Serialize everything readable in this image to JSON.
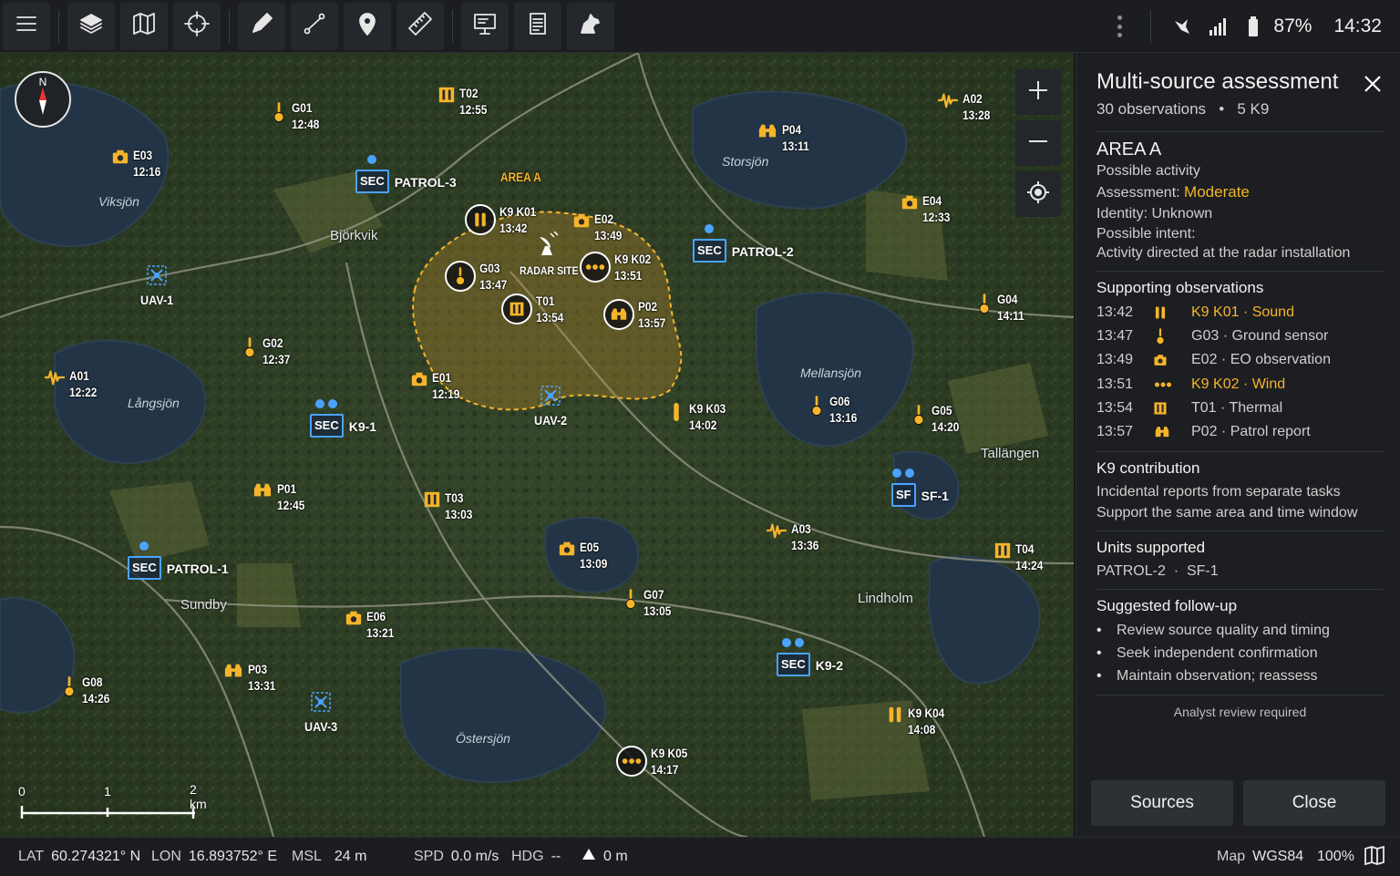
{
  "toolbar": {
    "buttons": [
      "menu-icon",
      "layers-icon",
      "map-icon",
      "crosshair-icon",
      "pencil-icon",
      "route-icon",
      "pin-icon",
      "ruler-icon",
      "presentation-icon",
      "report-icon",
      "dog-icon"
    ]
  },
  "status": {
    "battery": "87%",
    "time": "14:32"
  },
  "map": {
    "lakes": [
      "Viksjön",
      "Storsjön",
      "Långsjön",
      "Mellansjön",
      "Östersjön"
    ],
    "places": [
      "Björkvik",
      "Tallängen",
      "Sundby",
      "Lindholm"
    ],
    "compass": "N",
    "area": {
      "name": "AREA A",
      "radar": "RADAR SITE"
    },
    "scale": [
      "0",
      "1",
      "2 km"
    ],
    "markers": [
      {
        "id": "G01",
        "time": "12:48",
        "kind": "ground"
      },
      {
        "id": "T02",
        "time": "12:55",
        "kind": "thermal"
      },
      {
        "id": "E03",
        "time": "12:16",
        "kind": "eo"
      },
      {
        "id": "K9 K01",
        "time": "13:42",
        "kind": "sound"
      },
      {
        "id": "E02",
        "time": "13:49",
        "kind": "eo"
      },
      {
        "id": "K9 K02",
        "time": "13:51",
        "kind": "wind"
      },
      {
        "id": "G03",
        "time": "13:47",
        "kind": "ground"
      },
      {
        "id": "T01",
        "time": "13:54",
        "kind": "thermal"
      },
      {
        "id": "P02",
        "time": "13:57",
        "kind": "patrol"
      },
      {
        "id": "P04",
        "time": "13:11",
        "kind": "patrol"
      },
      {
        "id": "A02",
        "time": "13:28",
        "kind": "acoustic"
      },
      {
        "id": "E04",
        "time": "12:33",
        "kind": "eo"
      },
      {
        "id": "G04",
        "time": "14:11",
        "kind": "ground"
      },
      {
        "id": "G02",
        "time": "12:37",
        "kind": "ground"
      },
      {
        "id": "A01",
        "time": "12:22",
        "kind": "acoustic"
      },
      {
        "id": "E01",
        "time": "12:19",
        "kind": "eo"
      },
      {
        "id": "K9 K03",
        "time": "14:02",
        "kind": "k9single"
      },
      {
        "id": "G06",
        "time": "13:16",
        "kind": "ground"
      },
      {
        "id": "G05",
        "time": "14:20",
        "kind": "ground"
      },
      {
        "id": "P01",
        "time": "12:45",
        "kind": "patrol"
      },
      {
        "id": "T03",
        "time": "13:03",
        "kind": "thermal"
      },
      {
        "id": "E05",
        "time": "13:09",
        "kind": "eo"
      },
      {
        "id": "A03",
        "time": "13:36",
        "kind": "acoustic"
      },
      {
        "id": "T04",
        "time": "14:24",
        "kind": "thermal"
      },
      {
        "id": "G07",
        "time": "13:05",
        "kind": "ground"
      },
      {
        "id": "E06",
        "time": "13:21",
        "kind": "eo"
      },
      {
        "id": "P03",
        "time": "13:31",
        "kind": "patrol"
      },
      {
        "id": "G08",
        "time": "14:26",
        "kind": "ground"
      },
      {
        "id": "K9 K04",
        "time": "14:08",
        "kind": "sound"
      },
      {
        "id": "K9 K05",
        "time": "14:17",
        "kind": "wind"
      }
    ],
    "units": [
      {
        "box": "SEC",
        "name": "PATROL-3"
      },
      {
        "box": "SEC",
        "name": "PATROL-2"
      },
      {
        "box": "SEC",
        "name": "K9-1"
      },
      {
        "box": "SF",
        "name": "SF-1"
      },
      {
        "box": "SEC",
        "name": "PATROL-1"
      },
      {
        "box": "SEC",
        "name": "K9-2"
      }
    ],
    "uavs": [
      "UAV-1",
      "UAV-2",
      "UAV-3"
    ]
  },
  "panel": {
    "title": "Multi-source assessment",
    "subtitle_obs": "30 observations",
    "subtitle_dot": "•",
    "subtitle_k9": "5 K9",
    "area": {
      "name": "AREA A",
      "activity": "Possible activity",
      "assessment_label": "Assessment:",
      "assessment_value": "Moderate",
      "identity": "Identity: Unknown",
      "intent_label": "Possible intent:",
      "intent_value": "Activity directed at the radar installation"
    },
    "supporting": {
      "heading": "Supporting observations",
      "rows": [
        {
          "time": "13:42",
          "icon": "sound-icon",
          "text": "K9 K01 · Sound",
          "highlight": true
        },
        {
          "time": "13:47",
          "icon": "ground-sensor-icon",
          "text": "G03 · Ground sensor",
          "highlight": false
        },
        {
          "time": "13:49",
          "icon": "camera-icon",
          "text": "E02 · EO observation",
          "highlight": false
        },
        {
          "time": "13:51",
          "icon": "wind-icon",
          "text": "K9 K02 · Wind",
          "highlight": true
        },
        {
          "time": "13:54",
          "icon": "thermal-icon",
          "text": "T01 · Thermal",
          "highlight": false
        },
        {
          "time": "13:57",
          "icon": "binoculars-icon",
          "text": "P02 · Patrol report",
          "highlight": false
        }
      ]
    },
    "k9": {
      "heading": "K9 contribution",
      "line1": "Incidental reports from separate tasks",
      "line2": "Support the same area and time window"
    },
    "units": {
      "heading": "Units supported",
      "value": "PATROL-2  ·  SF-1"
    },
    "followup": {
      "heading": "Suggested follow-up",
      "items": [
        "Review source quality and timing",
        "Seek independent confirmation",
        "Maintain observation; reassess"
      ]
    },
    "analyst": "Analyst review required",
    "btn_sources": "Sources",
    "btn_close": "Close"
  },
  "statusbar": {
    "lat_k": "LAT",
    "lat_v": "60.274321° N",
    "lon_k": "LON",
    "lon_v": "16.893752° E",
    "msl_k": "MSL",
    "msl_v": "24 m",
    "spd_k": "SPD",
    "spd_v": "0.0 m/s",
    "hdg_k": "HDG",
    "hdg_v": "--",
    "alt_v": "0 m",
    "map_k": "Map",
    "map_v": "WGS84",
    "zoom": "100%"
  },
  "colors": {
    "accent": "#f5b42a",
    "unit_blue": "#4aa3ff",
    "panel_bg": "#1c1e21"
  }
}
